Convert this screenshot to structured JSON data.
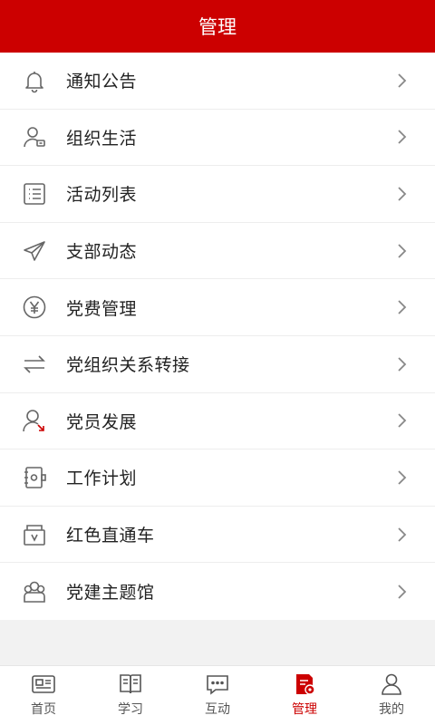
{
  "header": {
    "title": "管理"
  },
  "menu": {
    "items": [
      {
        "label": "通知公告",
        "icon": "bell-icon"
      },
      {
        "label": "组织生活",
        "icon": "user-card-icon"
      },
      {
        "label": "活动列表",
        "icon": "list-icon"
      },
      {
        "label": "支部动态",
        "icon": "paper-plane-icon"
      },
      {
        "label": "党费管理",
        "icon": "yen-icon"
      },
      {
        "label": "党组织关系转接",
        "icon": "transfer-arrows-icon"
      },
      {
        "label": "党员发展",
        "icon": "user-growth-icon"
      },
      {
        "label": "工作计划",
        "icon": "notebook-icon"
      },
      {
        "label": "红色直通车",
        "icon": "box-icon"
      },
      {
        "label": "党建主题馆",
        "icon": "group-icon"
      }
    ]
  },
  "tabbar": {
    "tabs": [
      {
        "label": "首页",
        "icon": "id-card-icon",
        "active": false
      },
      {
        "label": "学习",
        "icon": "book-icon",
        "active": false
      },
      {
        "label": "互动",
        "icon": "chat-bubble-icon",
        "active": false
      },
      {
        "label": "管理",
        "icon": "document-gear-icon",
        "active": true
      },
      {
        "label": "我的",
        "icon": "person-icon",
        "active": false
      }
    ],
    "active_color": "#cc0000",
    "inactive_color": "#555555"
  },
  "colors": {
    "brand": "#cc0000",
    "background": "#f2f2f2"
  }
}
